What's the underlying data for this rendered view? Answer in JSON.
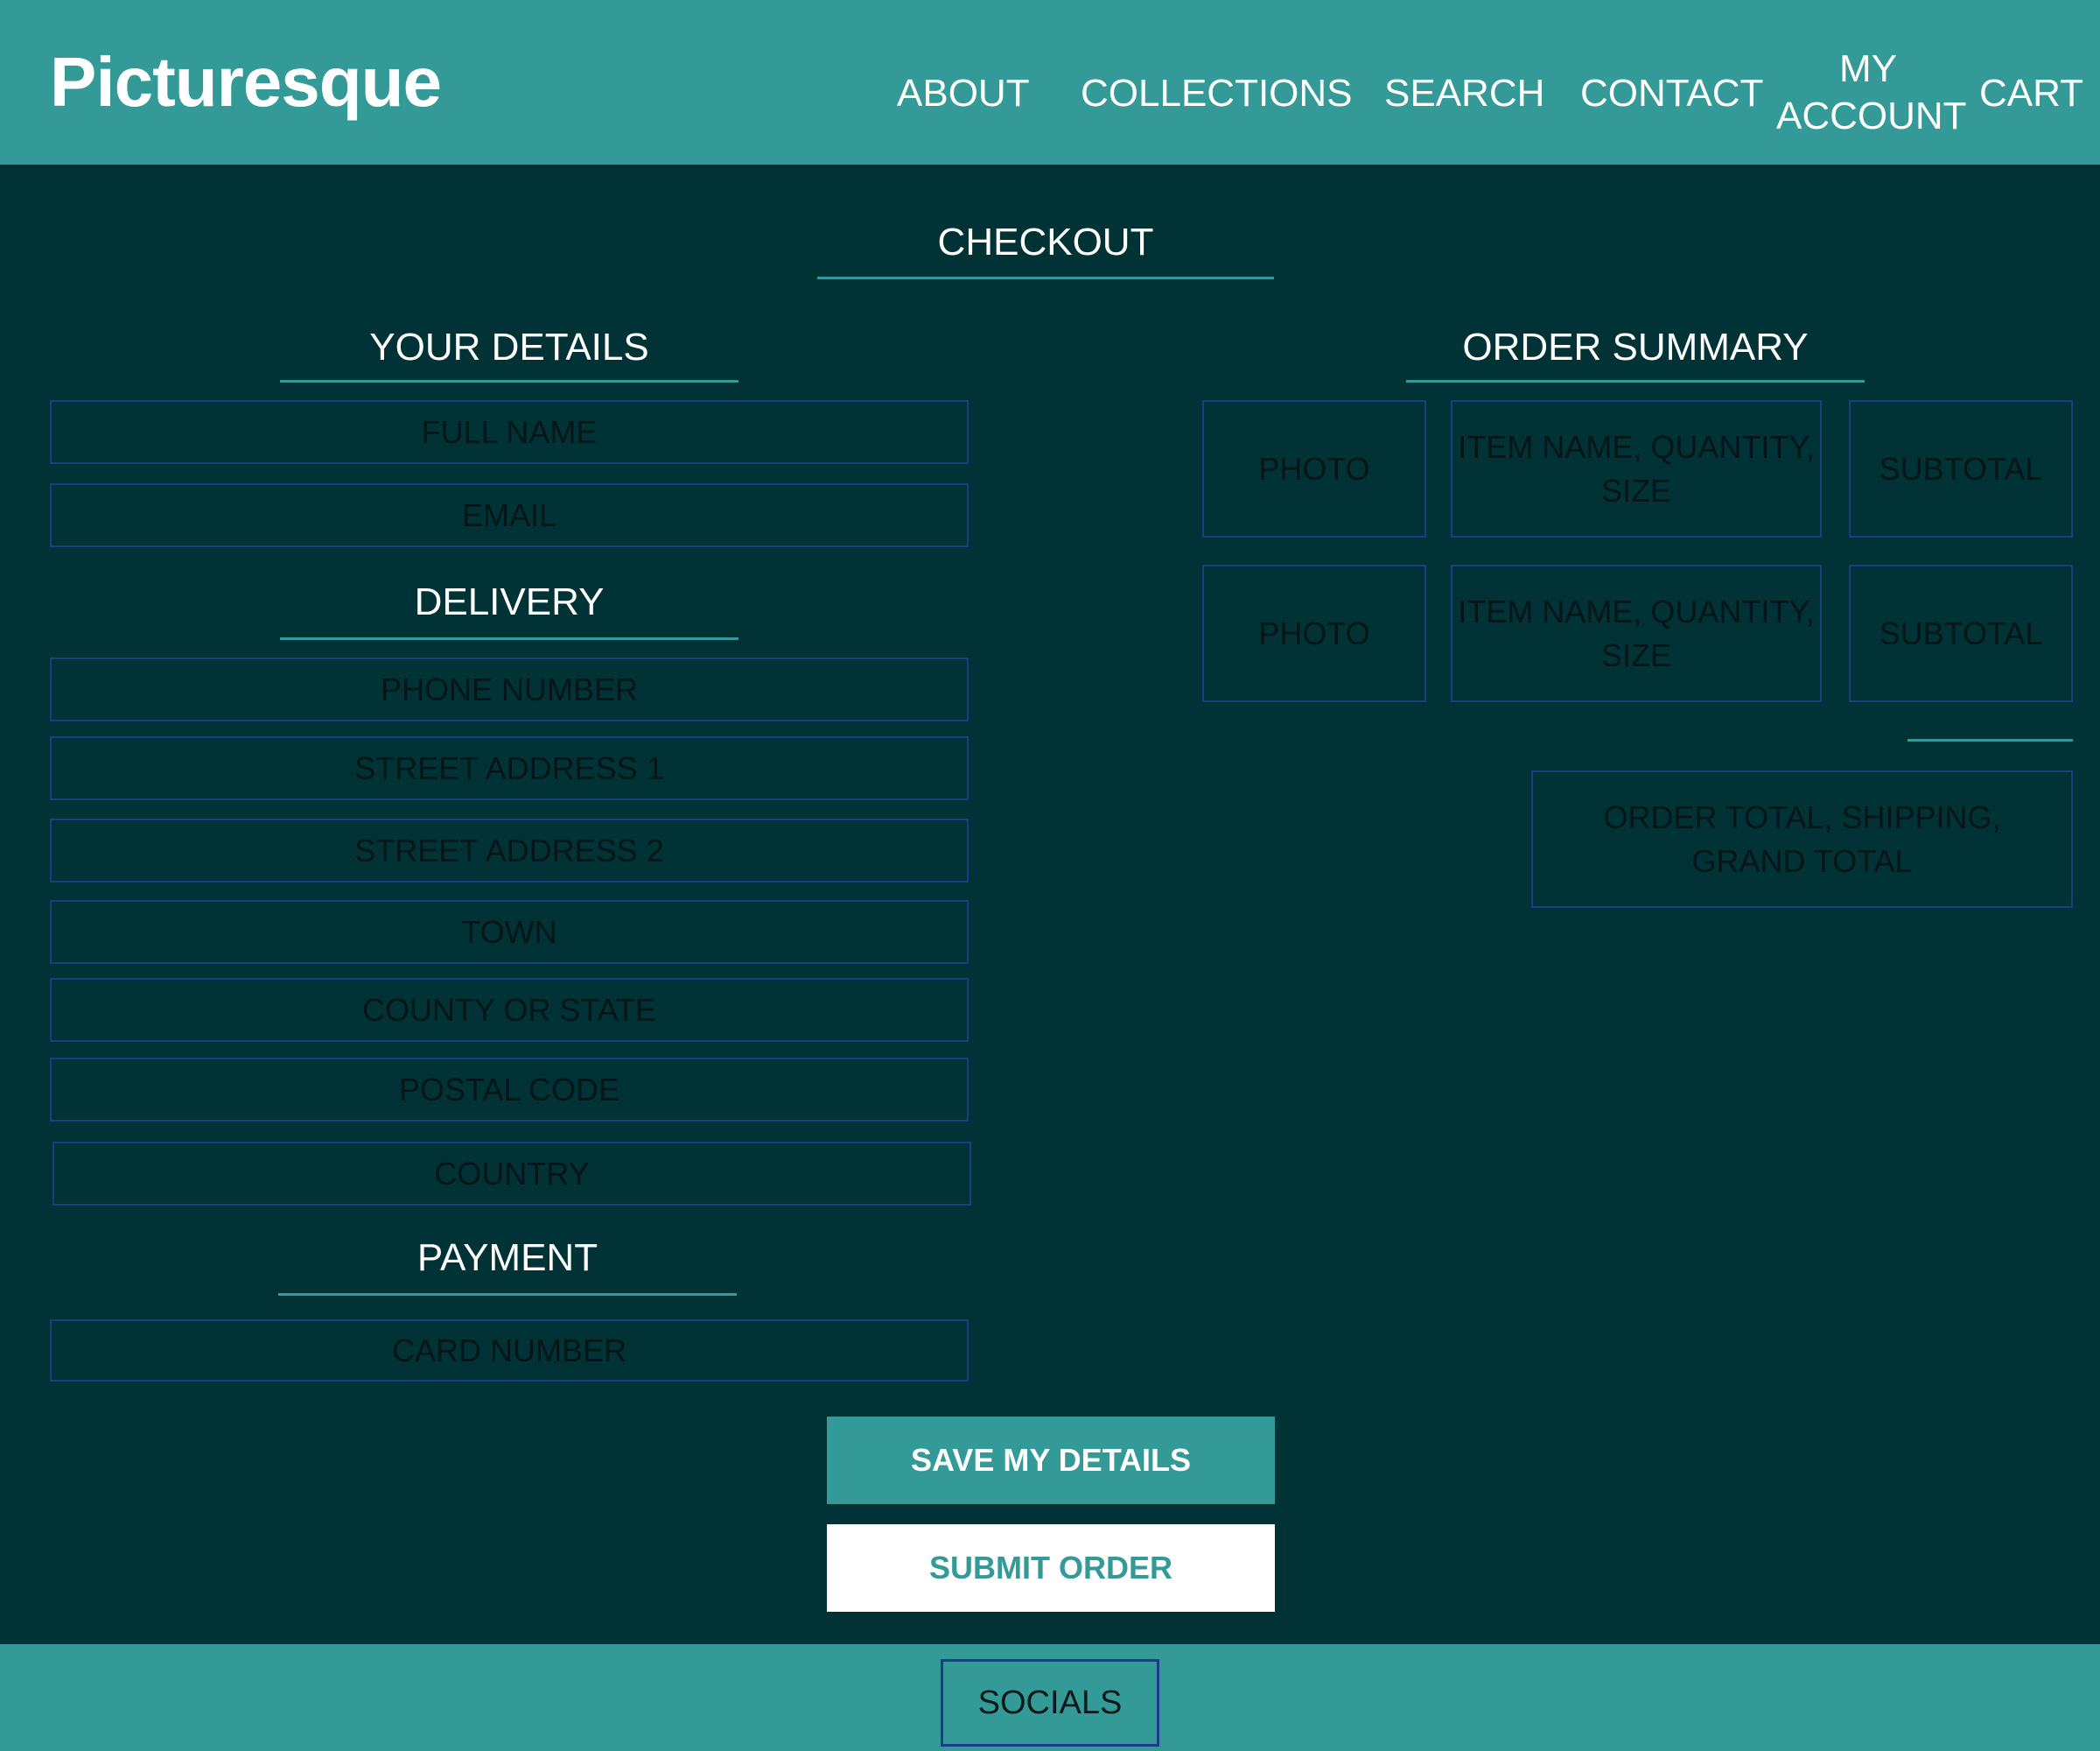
{
  "header": {
    "logo": "Picturesque",
    "nav": {
      "about": "ABOUT",
      "collections": "COLLECTIONS",
      "search": "SEARCH",
      "contact": "CONTACT",
      "my_account_line1": "MY",
      "my_account_line2": "ACCOUNT",
      "cart": "CART"
    }
  },
  "page_title": "CHECKOUT",
  "your_details": {
    "title": "YOUR DETAILS",
    "full_name": "FULL NAME",
    "email": "EMAIL"
  },
  "delivery": {
    "title": "DELIVERY",
    "phone": "PHONE NUMBER",
    "street1": "STREET ADDRESS 1",
    "street2": "STREET ADDRESS 2",
    "town": "TOWN",
    "county": "COUNTY OR STATE",
    "postal": "POSTAL CODE",
    "country": "COUNTRY"
  },
  "payment": {
    "title": "PAYMENT",
    "card_number": "CARD NUMBER"
  },
  "order_summary": {
    "title": "ORDER SUMMARY",
    "items": [
      {
        "photo": "PHOTO",
        "details": "ITEM NAME, QUANTITY, SIZE",
        "subtotal": "SUBTOTAL"
      },
      {
        "photo": "PHOTO",
        "details": "ITEM NAME, QUANTITY, SIZE",
        "subtotal": "SUBTOTAL"
      }
    ],
    "totals": "ORDER TOTAL, SHIPPING, GRAND TOTAL"
  },
  "buttons": {
    "save": "SAVE MY DETAILS",
    "submit": "SUBMIT ORDER"
  },
  "footer": {
    "socials": "SOCIALS"
  },
  "colors": {
    "background": "#003236",
    "accent": "#339a97",
    "field_border": "#1d3c86",
    "white": "#ffffff"
  }
}
